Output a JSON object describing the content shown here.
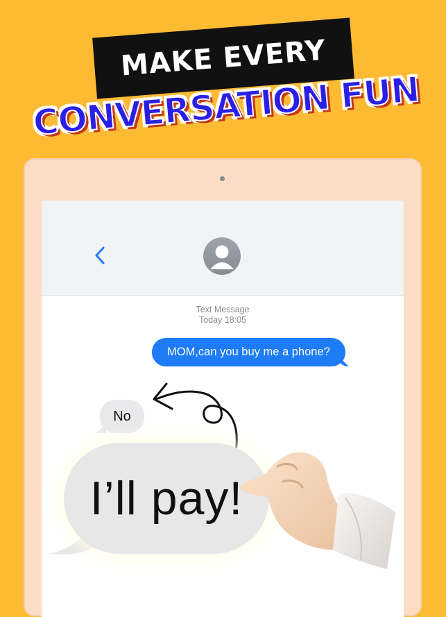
{
  "headline": {
    "line1": "MAKE EVERY",
    "line2": "CONVERSATION FUN"
  },
  "conversation": {
    "meta_title": "Text Message",
    "meta_time": "Today 18:05",
    "messages": [
      {
        "direction": "outgoing",
        "text": "MOM,can you buy me a phone?"
      },
      {
        "direction": "incoming",
        "text": "No"
      },
      {
        "direction": "incoming-highlight",
        "text": "I’ll pay!"
      }
    ]
  },
  "icons": {
    "back": "chevron-left-icon",
    "avatar": "contact-avatar-icon",
    "arrow": "curved-arrow-icon",
    "hand": "pointing-hand-icon"
  },
  "colors": {
    "background": "#FDBB34",
    "headline_blue": "#2B1FE6",
    "imessage_blue": "#1E7CF7",
    "bubble_gray": "#E9E9EB",
    "tablet_frame": "#FCDCC5"
  }
}
